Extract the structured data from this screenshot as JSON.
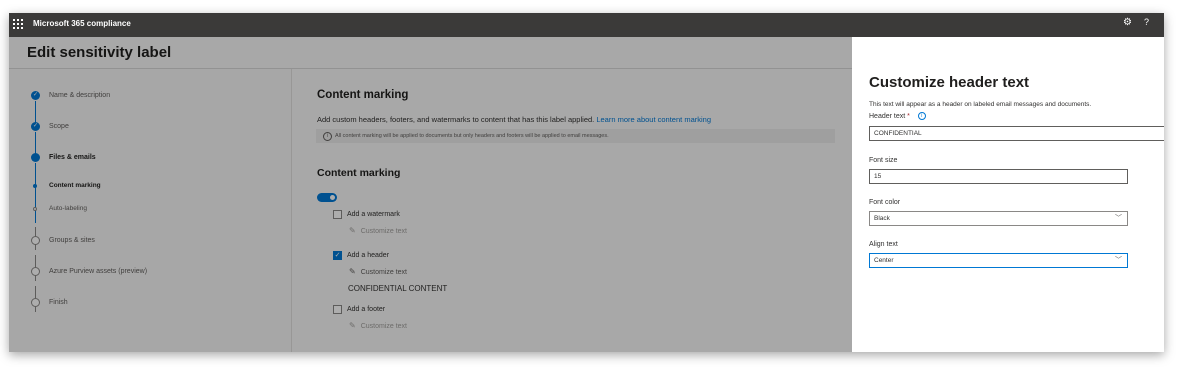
{
  "app": {
    "title": "Microsoft 365 compliance"
  },
  "header": {
    "settings_icon": "gear-icon",
    "help_label": "?"
  },
  "page": {
    "title": "Edit sensitivity label"
  },
  "steps": [
    {
      "label": "Name & description",
      "state": "done"
    },
    {
      "label": "Scope",
      "state": "done"
    },
    {
      "label": "Files & emails",
      "state": "current"
    },
    {
      "label": "Content marking",
      "state": "sub-current"
    },
    {
      "label": "Auto-labeling",
      "state": "sub-open"
    },
    {
      "label": "Groups & sites",
      "state": "open"
    },
    {
      "label": "Azure Purview assets (preview)",
      "state": "open"
    },
    {
      "label": "Finish",
      "state": "open"
    }
  ],
  "main": {
    "heading": "Content marking",
    "description": "Add custom headers, footers, and watermarks to content that has this label applied.",
    "learn_more": "Learn more about content marking",
    "info_text": "All content marking will be applied to documents but only headers and footers will be applied to email messages.",
    "section_heading": "Content marking",
    "toggle_on": true,
    "options": [
      {
        "label": "Add a watermark",
        "checked": false,
        "customize": "Customize text",
        "value": ""
      },
      {
        "label": "Add a header",
        "checked": true,
        "customize": "Customize text",
        "value": "CONFIDENTIAL CONTENT"
      },
      {
        "label": "Add a footer",
        "checked": false,
        "customize": "Customize text",
        "value": ""
      }
    ]
  },
  "panel": {
    "title": "Customize header text",
    "description": "This text will appear as a header on labeled email messages and documents.",
    "header_text_label": "Header text",
    "required_mark": "*",
    "header_text_value": "CONFIDENTIAL",
    "font_size_label": "Font size",
    "font_size_value": "15",
    "font_color_label": "Font color",
    "font_color_value": "Black",
    "align_label": "Align text",
    "align_value": "Center"
  },
  "colors": {
    "accent": "#0078d4",
    "topbar": "#3b3a39"
  }
}
